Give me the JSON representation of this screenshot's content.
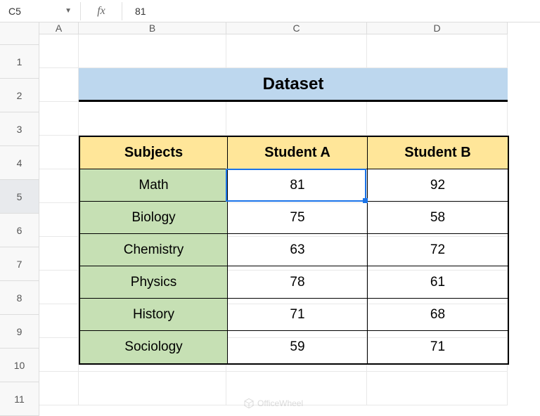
{
  "name_box": "C5",
  "formula_value": "81",
  "fx_label": "fx",
  "columns": [
    "A",
    "B",
    "C",
    "D"
  ],
  "rows": [
    "1",
    "2",
    "3",
    "4",
    "5",
    "6",
    "7",
    "8",
    "9",
    "10",
    "11"
  ],
  "selected_row": "5",
  "dataset": {
    "title": "Dataset",
    "headers": [
      "Subjects",
      "Student A",
      "Student B"
    ],
    "data": [
      {
        "subject": "Math",
        "a": "81",
        "b": "92"
      },
      {
        "subject": "Biology",
        "a": "75",
        "b": "58"
      },
      {
        "subject": "Chemistry",
        "a": "63",
        "b": "72"
      },
      {
        "subject": "Physics",
        "a": "78",
        "b": "61"
      },
      {
        "subject": "History",
        "a": "71",
        "b": "68"
      },
      {
        "subject": "Sociology",
        "a": "59",
        "b": "71"
      }
    ]
  },
  "watermark": "OfficeWheel"
}
